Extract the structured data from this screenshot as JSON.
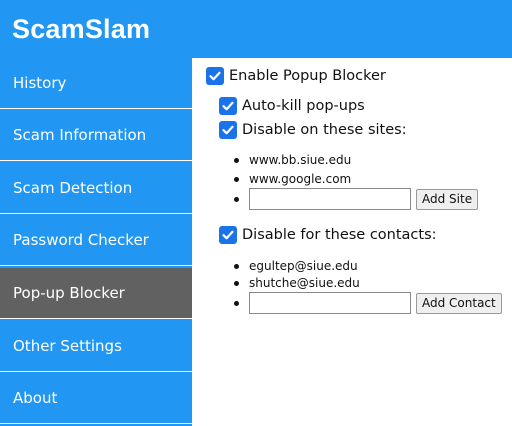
{
  "app": {
    "title": "ScamSlam"
  },
  "sidebar": {
    "items": [
      {
        "label": "History"
      },
      {
        "label": "Scam Information"
      },
      {
        "label": "Scam Detection"
      },
      {
        "label": "Password Checker"
      },
      {
        "label": "Pop-up Blocker",
        "active": true
      },
      {
        "label": "Other Settings"
      },
      {
        "label": "About"
      }
    ]
  },
  "popup_blocker": {
    "enable": {
      "label": "Enable Popup Blocker",
      "checked": true
    },
    "auto_kill": {
      "label": "Auto-kill pop-ups",
      "checked": true
    },
    "sites": {
      "label": "Disable on these sites:",
      "checked": true,
      "items": [
        "www.bb.siue.edu",
        "www.google.com"
      ],
      "input_value": "",
      "add_button": "Add Site"
    },
    "contacts": {
      "label": "Disable for these contacts:",
      "checked": true,
      "items": [
        "egultep@siue.edu",
        "shutche@siue.edu"
      ],
      "input_value": "",
      "add_button": "Add Contact"
    }
  },
  "colors": {
    "primary": "#2196f3",
    "active": "#616161",
    "checkbox": "#1a73e8"
  }
}
